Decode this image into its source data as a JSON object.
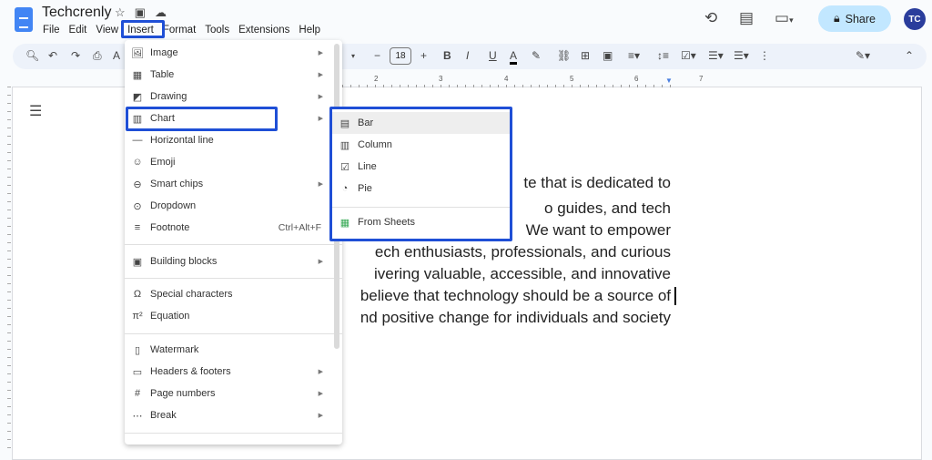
{
  "doc": {
    "title": "Techcrenly",
    "share_label": "Share",
    "avatar_initials": "TC",
    "font_size": "18"
  },
  "menubar": [
    "File",
    "Edit",
    "View",
    "Insert",
    "Format",
    "Tools",
    "Extensions",
    "Help"
  ],
  "ruler_numbers": [
    "2",
    "3",
    "4",
    "5",
    "6",
    "7"
  ],
  "insert_menu": [
    {
      "label": "Image",
      "icon": "image-icon",
      "submenu": true
    },
    {
      "label": "Table",
      "icon": "table-icon",
      "submenu": true
    },
    {
      "label": "Drawing",
      "icon": "drawing-icon",
      "submenu": true
    },
    {
      "label": "Chart",
      "icon": "chart-icon",
      "submenu": true
    },
    {
      "label": "Horizontal line",
      "icon": "horizontal-line-icon"
    },
    {
      "label": "Emoji",
      "icon": "emoji-icon"
    },
    {
      "label": "Smart chips",
      "icon": "smart-chips-icon",
      "submenu": true
    },
    {
      "label": "Dropdown",
      "icon": "dropdown-icon"
    },
    {
      "label": "Footnote",
      "icon": "footnote-icon",
      "shortcut": "Ctrl+Alt+F"
    },
    {
      "label": "Building blocks",
      "icon": "building-blocks-icon",
      "submenu": true
    },
    {
      "label": "Special characters",
      "icon": "omega-icon"
    },
    {
      "label": "Equation",
      "icon": "pi-icon"
    },
    {
      "label": "Watermark",
      "icon": "watermark-icon"
    },
    {
      "label": "Headers & footers",
      "icon": "headers-footers-icon",
      "submenu": true
    },
    {
      "label": "Page numbers",
      "icon": "hash-icon",
      "submenu": true
    },
    {
      "label": "Break",
      "icon": "break-icon",
      "submenu": true
    }
  ],
  "chart_submenu": [
    {
      "label": "Bar",
      "icon": "bar-chart-icon"
    },
    {
      "label": "Column",
      "icon": "column-chart-icon"
    },
    {
      "label": "Line",
      "icon": "line-chart-icon"
    },
    {
      "label": "Pie",
      "icon": "pie-chart-icon"
    },
    {
      "label": "From Sheets",
      "icon": "sheets-icon",
      "color": "#34a853"
    }
  ],
  "document_lines": [
    "te that is dedicated to",
    "o  guides,  and  tech",
    "We  want  to  empower",
    "ech  enthusiasts,  professionals,  and  curious",
    "ivering  valuable,  accessible,  and  innovative",
    "believe that technology should be a source of",
    "nd positive change for individuals and society"
  ],
  "colors": {
    "accent": "#1f4fd6",
    "share_bg": "#c2e7ff",
    "docs_blue": "#4285f4"
  }
}
